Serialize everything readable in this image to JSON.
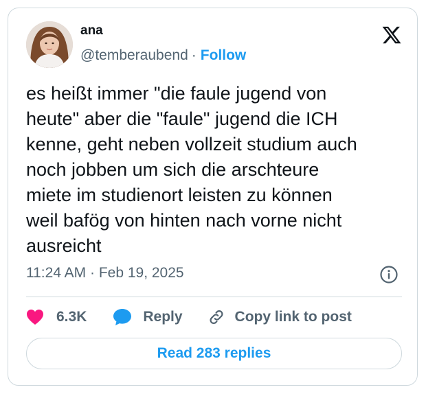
{
  "author": {
    "name": "ana",
    "handle": "@temberaubend",
    "separator": "·",
    "follow_label": "Follow",
    "avatar_icon": "profile-photo"
  },
  "tweet": {
    "text": "es heißt immer \"die faule jugend von\nheute\" aber die \"faule\" jugend die ICH\nkenne, geht neben vollzeit studium auch\nnoch jobben um sich die arschteure\nmiete im studienort leisten zu können\nweil bafög von hinten nach vorne nicht\nausreicht",
    "timestamp": "11:24 AM · Feb 19, 2025"
  },
  "actions": {
    "like_count": "6.3K",
    "reply_label": "Reply",
    "copy_link_label": "Copy link to post",
    "read_replies_label": "Read 283 replies"
  },
  "icons": {
    "brand": "x-logo-icon",
    "info": "info-icon",
    "like": "heart-icon",
    "reply": "speech-bubble-icon",
    "copy_link": "link-icon"
  },
  "colors": {
    "accent": "#1d9bf0",
    "like": "#f91880",
    "text_primary": "#0f1419",
    "text_secondary": "#536471",
    "border": "#cfd9de"
  }
}
